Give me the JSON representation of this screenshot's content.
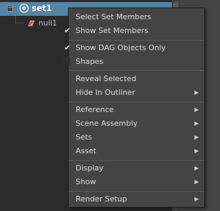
{
  "outliner": {
    "items": [
      {
        "label": "set1",
        "icon": "set-icon",
        "selected": true
      },
      {
        "label": "null1",
        "icon": "null-transform-icon",
        "selected": false
      }
    ],
    "expander_symbol": "−"
  },
  "context_menu": {
    "items": [
      {
        "label": "Select Set Members",
        "checked": null,
        "submenu": false
      },
      {
        "label": "Show Set Members",
        "checked": true,
        "submenu": false
      },
      {
        "label": "Show DAG Objects Only",
        "checked": true,
        "submenu": false
      },
      {
        "label": "Shapes",
        "checked": false,
        "submenu": false
      },
      {
        "label": "Reveal Selected",
        "checked": null,
        "submenu": false
      },
      {
        "label": "Hide In Outliner",
        "checked": null,
        "submenu": true
      },
      {
        "label": "Reference",
        "checked": null,
        "submenu": true
      },
      {
        "label": "Scene Assembly",
        "checked": null,
        "submenu": true
      },
      {
        "label": "Sets",
        "checked": null,
        "submenu": true
      },
      {
        "label": "Asset",
        "checked": null,
        "submenu": true
      },
      {
        "label": "Display",
        "checked": null,
        "submenu": true
      },
      {
        "label": "Show",
        "checked": null,
        "submenu": true
      },
      {
        "label": "Render Setup",
        "checked": null,
        "submenu": true
      }
    ],
    "check_glyph": "✔",
    "arrow_glyph": "▶"
  },
  "colors": {
    "selection": "#5285a6",
    "menu_bg": "#444444",
    "outliner_bg": "#2b2b2b"
  }
}
